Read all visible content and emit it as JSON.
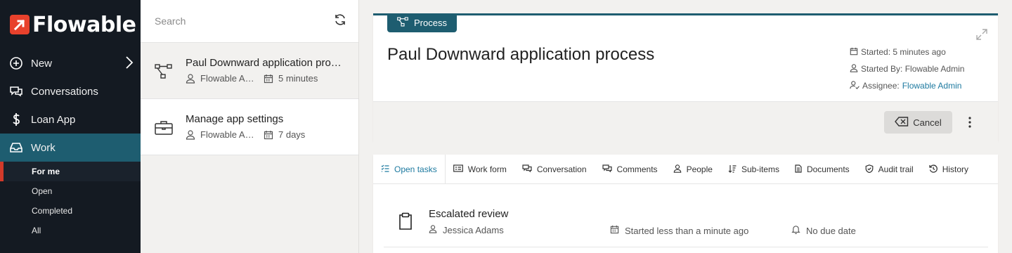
{
  "sidebar": {
    "logo_text": "Flowable",
    "nav": [
      {
        "label": "New",
        "icon": "plus-circle-icon"
      },
      {
        "label": "Conversations",
        "icon": "chat-icon"
      },
      {
        "label": "Loan App",
        "icon": "dollar-icon"
      },
      {
        "label": "Work",
        "icon": "inbox-icon"
      }
    ],
    "sub": [
      {
        "label": "For me"
      },
      {
        "label": "Open"
      },
      {
        "label": "Completed"
      },
      {
        "label": "All"
      }
    ]
  },
  "search": {
    "placeholder": "Search"
  },
  "list": [
    {
      "title": "Paul Downward application process",
      "owner": "Flowable Admin",
      "time": "5 minutes",
      "icon": "process-icon"
    },
    {
      "title": "Manage app settings",
      "owner": "Flowable Admin",
      "time": "7 days",
      "icon": "briefcase-icon"
    }
  ],
  "detail": {
    "badge": "Process",
    "title": "Paul Downward application process",
    "started": "Started: 5 minutes ago",
    "started_by": "Started By: Flowable Admin",
    "assignee_label": "Assignee:",
    "assignee": "Flowable Admin",
    "cancel_label": "Cancel"
  },
  "tabs": [
    {
      "label": "Open tasks",
      "icon": "checklist-icon"
    },
    {
      "label": "Work form",
      "icon": "form-icon"
    },
    {
      "label": "Conversation",
      "icon": "chat-icon"
    },
    {
      "label": "Comments",
      "icon": "comments-icon"
    },
    {
      "label": "People",
      "icon": "person-icon"
    },
    {
      "label": "Sub-items",
      "icon": "sort-icon"
    },
    {
      "label": "Documents",
      "icon": "document-icon"
    },
    {
      "label": "Audit trail",
      "icon": "shield-icon"
    },
    {
      "label": "History",
      "icon": "history-icon"
    }
  ],
  "task": {
    "title": "Escalated review",
    "assignee": "Jessica Adams",
    "started": "Started less than a minute ago",
    "due": "No due date"
  },
  "colors": {
    "brand": "#e8412c",
    "accent": "#1e5d70",
    "link": "#1e7aa0",
    "sidebar": "#141a22"
  }
}
